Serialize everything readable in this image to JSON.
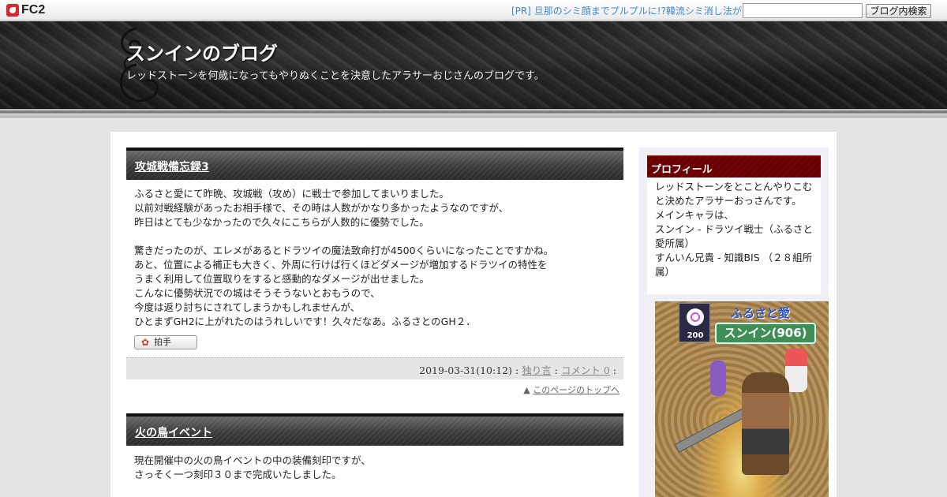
{
  "fc2bar": {
    "logo_text": "FC2",
    "pr_text": "[PR] 旦那のシミ顔までプルプルに!?韓流シミ消し法が",
    "search_placeholder": "",
    "search_button": "ブログ内検索"
  },
  "header": {
    "title": "スンインのブログ",
    "description": "レッドストーンを何歳になってもやりぬくことを決意したアラサーおじさんのブログです。"
  },
  "entries": [
    {
      "title": "攻城戦備忘録3",
      "lines": [
        "ふるさと愛にて昨晩、攻城戦（攻め）に戦士で参加してまいりました。",
        "以前対戦経験があったお相手様で、その時は人数がかなり多かったようなのですが、",
        "昨日はとても少なかったので久々にこちらが人数的に優勢でした。",
        "",
        "驚きだったのが、エレメがあるとドラツイの魔法致命打が4500くらいになったことですかね。",
        "あと、位置による補正も大きく、外周に行けば行くほどダメージが増加するドラツイの特性を",
        "うまく利用して位置取りをすると感動的なダメージが出せました。",
        "こんなに優勢状況での城はそうそうないとおもうので、",
        "今度は返り討ちにされてしまうかもしれませんが、",
        "ひとまずGH2に上がれたのはうれしいです！久々だなあ。ふるさとのGH２．"
      ],
      "clap_label": "拍手",
      "datetime": "2019-03-31(10:12)",
      "category": "独り言",
      "comments": "コメント 0",
      "pagetop": "このページのトップへ"
    },
    {
      "title": "火の鳥イベント",
      "lines": [
        "現在開催中の火の鳥イベントの中の装備刻印ですが、",
        "さっそく一つ刻印３０まで完成いたしました。"
      ]
    }
  ],
  "sidebar": {
    "profile_heading": "プロフィール",
    "profile_lines": [
      "レッドストーンをとことんやりこむと決めたアラサーおっさんです。",
      "メインキャラは、",
      "スンイン - ドラツイ戦士（ふるさと愛所属）",
      "すんいん兄貴 - 知識BIS （２８組所属）"
    ],
    "avatar": {
      "guild_name": "ふるさと愛",
      "char_name": "スンイン(906)",
      "emblem_number": "200"
    }
  }
}
